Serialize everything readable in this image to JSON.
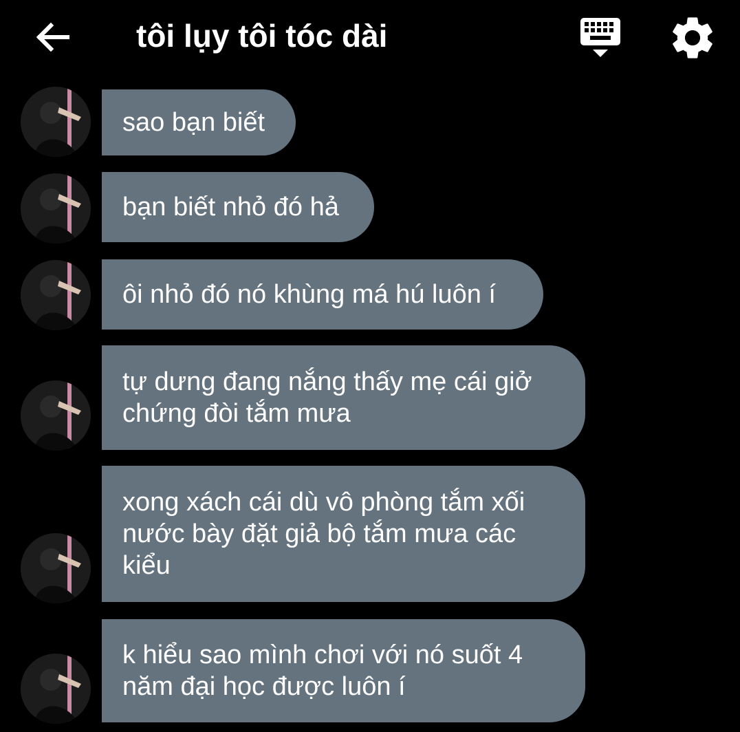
{
  "header": {
    "title": "tôi lụy tôi tóc dài",
    "back_icon": "arrow-left-icon",
    "keyboard_icon": "keyboard-icon",
    "settings_icon": "gear-icon"
  },
  "colors": {
    "background": "#000000",
    "bubble": "#65737f",
    "text": "#ffffff"
  },
  "messages": [
    {
      "text": "sao bạn biết"
    },
    {
      "text": "bạn biết nhỏ đó hả"
    },
    {
      "text": "ôi nhỏ đó nó khùng má hú luôn í"
    },
    {
      "text": "tự dưng đang nắng thấy mẹ cái giở\nchứng đòi tắm mưa"
    },
    {
      "text": "xong xách cái dù vô phòng tắm xối\nnước bày đặt giả bộ tắm mưa các\nkiểu"
    },
    {
      "text": "k hiểu sao mình chơi với nó suốt 4\nnăm đại học được luôn í"
    }
  ]
}
